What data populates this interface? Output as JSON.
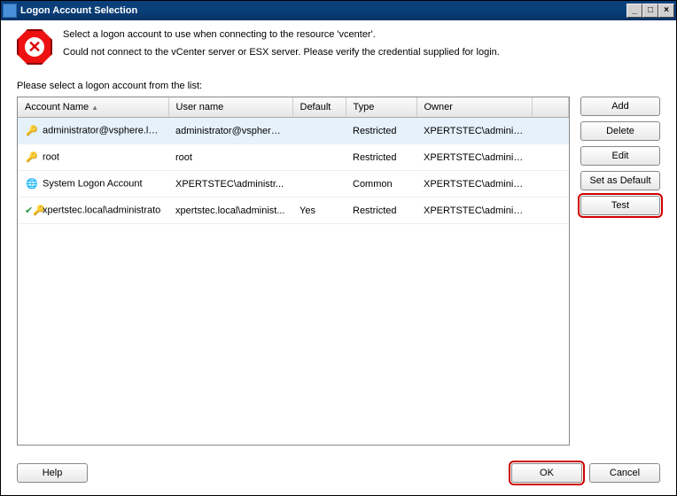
{
  "window": {
    "title": "Logon Account Selection"
  },
  "message": {
    "line1": "Select a logon account to use when connecting to the resource 'vcenter'.",
    "line2": "Could not connect to the vCenter server or ESX server. Please verify the credential supplied for login."
  },
  "list_label": "Please select a logon account from the list:",
  "columns": {
    "account": "Account Name",
    "user": "User name",
    "default": "Default",
    "type": "Type",
    "owner": "Owner"
  },
  "rows": [
    {
      "icon": "key",
      "account": "administrator@vsphere.loca",
      "user": "administrator@vsphere....",
      "default": "",
      "type": "Restricted",
      "owner": "XPERTSTEC\\adminis...",
      "selected": true
    },
    {
      "icon": "key",
      "account": "root",
      "user": "root",
      "default": "",
      "type": "Restricted",
      "owner": "XPERTSTEC\\adminis...",
      "selected": false
    },
    {
      "icon": "globe",
      "account": "System Logon Account",
      "user": "XPERTSTEC\\administr...",
      "default": "",
      "type": "Common",
      "owner": "XPERTSTEC\\adminis...",
      "selected": false
    },
    {
      "icon": "keyok",
      "account": "xpertstec.local\\administrato",
      "user": "xpertstec.local\\administ...",
      "default": "Yes",
      "type": "Restricted",
      "owner": "XPERTSTEC\\adminis...",
      "selected": false
    }
  ],
  "buttons": {
    "add": "Add",
    "delete": "Delete",
    "edit": "Edit",
    "set_default": "Set as Default",
    "test": "Test",
    "help": "Help",
    "ok": "OK",
    "cancel": "Cancel"
  }
}
